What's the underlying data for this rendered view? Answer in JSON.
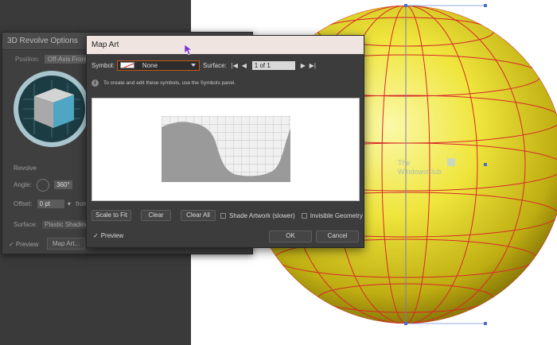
{
  "revolve_panel": {
    "title": "3D Revolve Options",
    "position_label": "Position:",
    "position_value": "Off-Axis Front",
    "revolve_section": "Revolve",
    "angle_label": "Angle:",
    "angle_value": "360°",
    "offset_label": "Offset:",
    "offset_value": "0 pt",
    "offset_from": "from",
    "surface_label": "Surface:",
    "surface_value": "Plastic Shading",
    "preview_label": "Preview",
    "map_art_button": "Map Art..."
  },
  "map_art": {
    "title": "Map Art",
    "symbol_label": "Symbol:",
    "symbol_value": "None",
    "surface_label": "Surface:",
    "surface_page": "1 of 1",
    "info_text": "To create and edit these symbols, use the Symbols panel.",
    "buttons": {
      "scale_to_fit": "Scale to Fit",
      "clear": "Clear",
      "clear_all": "Clear All",
      "ok": "OK",
      "cancel": "Cancel"
    },
    "shade_artwork_label": "Shade Artwork (slower)",
    "invisible_geometry_label": "Invisible Geometry",
    "preview_label": "Preview",
    "preview_checked": true,
    "shade_artwork_checked": false,
    "invisible_geometry_checked": false
  },
  "watermark": {
    "line1": "The",
    "line2": "WindowsClub"
  },
  "colors": {
    "accent": "#c1541a",
    "sphere": "#e8e23a",
    "mesh": "#d62828",
    "dialog_bg": "#3c3c3c",
    "titlebar": "#efe4e0"
  }
}
